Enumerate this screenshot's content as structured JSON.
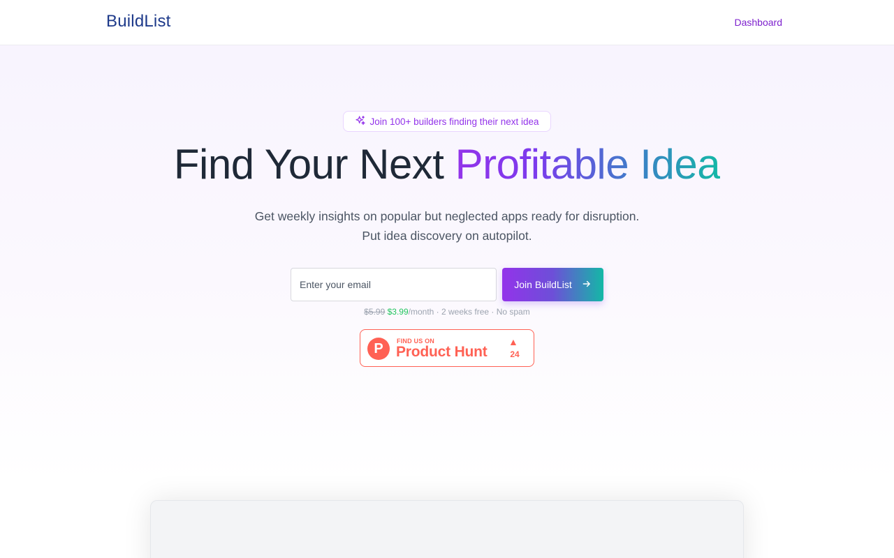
{
  "header": {
    "logo": "BuildList",
    "nav": {
      "dashboard_label": "Dashboard"
    }
  },
  "hero": {
    "badge": {
      "icon": "sparkles-icon",
      "text": "Join 100+ builders finding their next idea"
    },
    "headline": {
      "plain": "Find Your Next",
      "highlight": "Profitable Idea"
    },
    "subheadline": {
      "line1": "Get weekly insights on popular but neglected apps ready for disruption.",
      "line2": "Put idea discovery on autopilot."
    },
    "form": {
      "email_placeholder": "Enter your email",
      "email_value": "",
      "button_label": "Join BuildList",
      "button_icon": "arrow-right-icon"
    },
    "pricing": {
      "old_price": "$5.99",
      "new_price": "$3.99",
      "rest": "/month · 2 weeks free · No spam"
    },
    "product_hunt": {
      "logo_letter": "P",
      "small_text": "FIND US ON",
      "big_text": "Product Hunt",
      "arrow": "▲",
      "upvotes": "24"
    }
  },
  "colors": {
    "brand_purple": "#9333ea",
    "brand_teal": "#14b8a6",
    "logo_blue": "#1e3a8a",
    "product_hunt": "#ff6154",
    "price_green": "#22c55e"
  }
}
